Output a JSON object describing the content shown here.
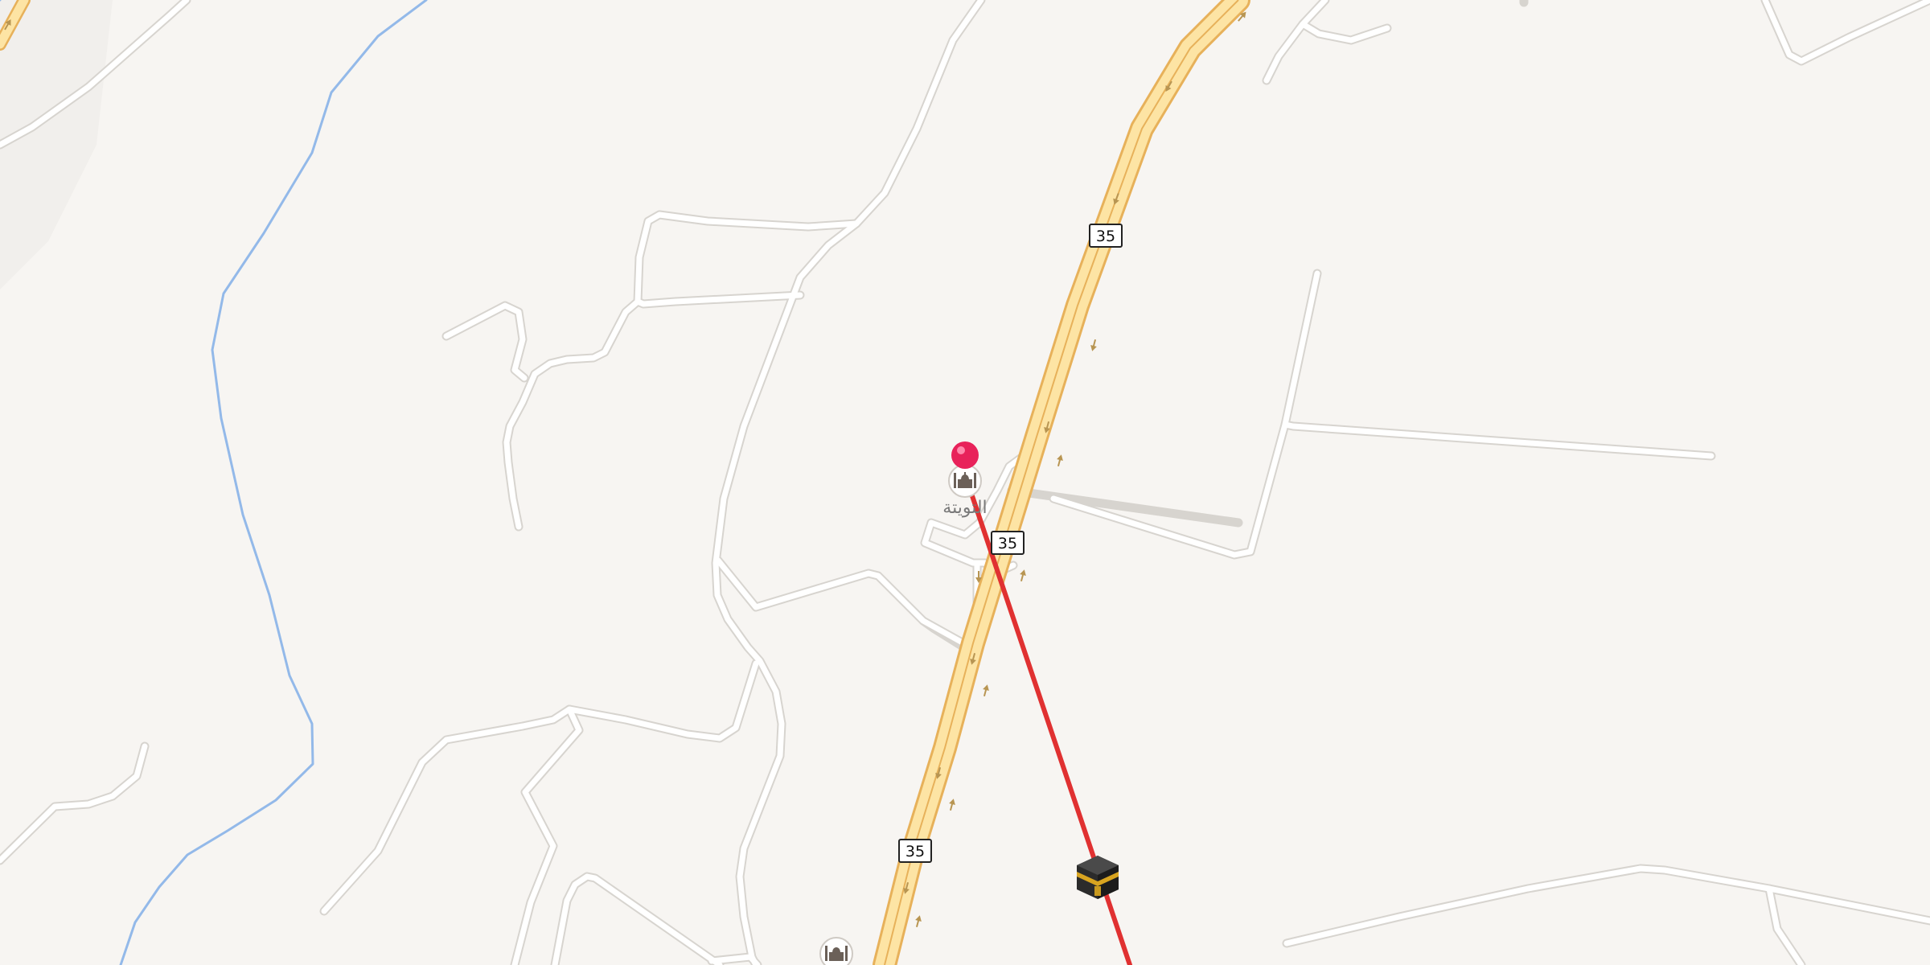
{
  "map": {
    "colors": {
      "land": "#f7f5f2",
      "road": "#ffffff",
      "highway": "#fde4a4",
      "highway_casing": "#e7b15a",
      "water": "#93b9e9",
      "route_line": "#e03131",
      "pin": "#e8225a"
    },
    "route_shields": [
      {
        "label": "35"
      },
      {
        "label": "35"
      },
      {
        "label": "35"
      }
    ],
    "places": [
      {
        "label": "التويتة",
        "icon": "mosque-icon"
      }
    ],
    "markers": [
      {
        "name": "dropped-pin",
        "icon": "pin-icon"
      },
      {
        "name": "kaaba-marker",
        "icon": "kaaba-icon"
      },
      {
        "name": "mosque-marker-south",
        "icon": "mosque-icon"
      }
    ],
    "overlay": {
      "type": "qibla-direction-line"
    }
  }
}
